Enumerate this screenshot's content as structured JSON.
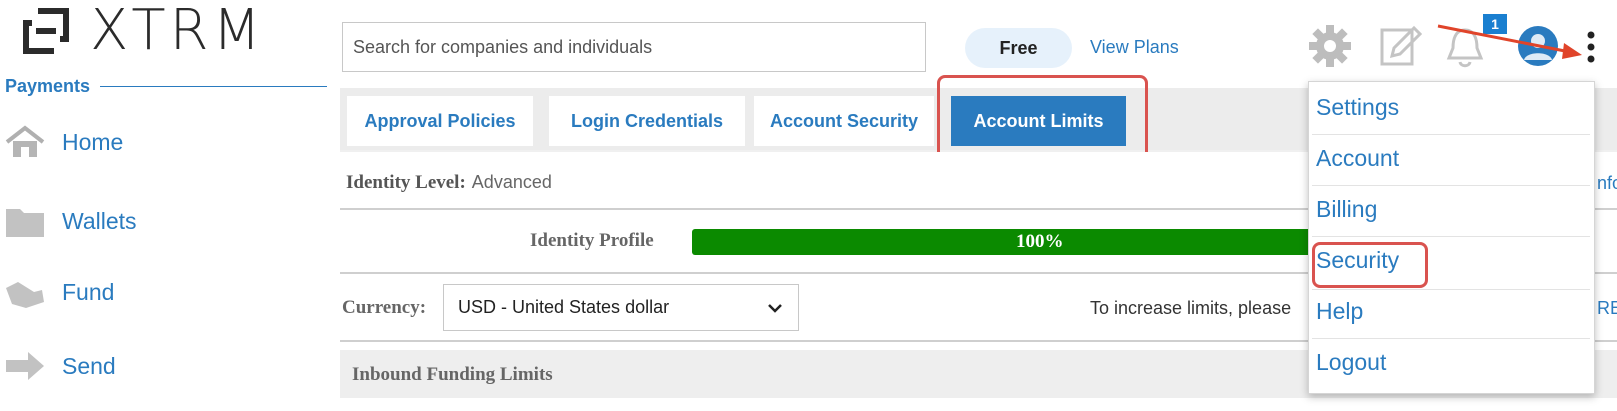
{
  "brand": {
    "name": "XTRM"
  },
  "sidebar": {
    "section_title": "Payments",
    "items": [
      {
        "label": "Home",
        "icon": "home-icon"
      },
      {
        "label": "Wallets",
        "icon": "folder-icon"
      },
      {
        "label": "Fund",
        "icon": "fund-icon"
      },
      {
        "label": "Send",
        "icon": "send-arrow-icon"
      }
    ]
  },
  "header": {
    "search": {
      "placeholder": "Search for companies and individuals",
      "value": ""
    },
    "plan_badge": "Free",
    "view_plans": "View Plans",
    "notification_count": "1",
    "icons": [
      "gear-icon",
      "edit-icon",
      "bell-icon",
      "user-avatar-icon",
      "more-vertical-icon"
    ]
  },
  "tabs": [
    {
      "label": "Approval Policies",
      "active": false
    },
    {
      "label": "Login Credentials",
      "active": false
    },
    {
      "label": "Account Security",
      "active": false
    },
    {
      "label": "Account Limits",
      "active": true
    }
  ],
  "identity": {
    "level_label": "Identity Level:",
    "level_value": "Advanced",
    "profile_label": "Identity Profile",
    "profile_percent_text": "100%",
    "profile_fraction": 1.0
  },
  "currency": {
    "label": "Currency:",
    "selected": "USD - United States dollar"
  },
  "increase_limits_text": "To increase limits, please",
  "inbound_title": "Inbound Funding Limits",
  "partial_edge_texts": [
    "nfo",
    "RE"
  ],
  "user_menu": {
    "items": [
      "Settings",
      "Account",
      "Billing",
      "Security",
      "Help",
      "Logout"
    ]
  },
  "colors": {
    "accent": "#2a7bbf",
    "progress": "#0b8a00",
    "highlight": "#d9534f",
    "badge": "#1a7fd0"
  }
}
